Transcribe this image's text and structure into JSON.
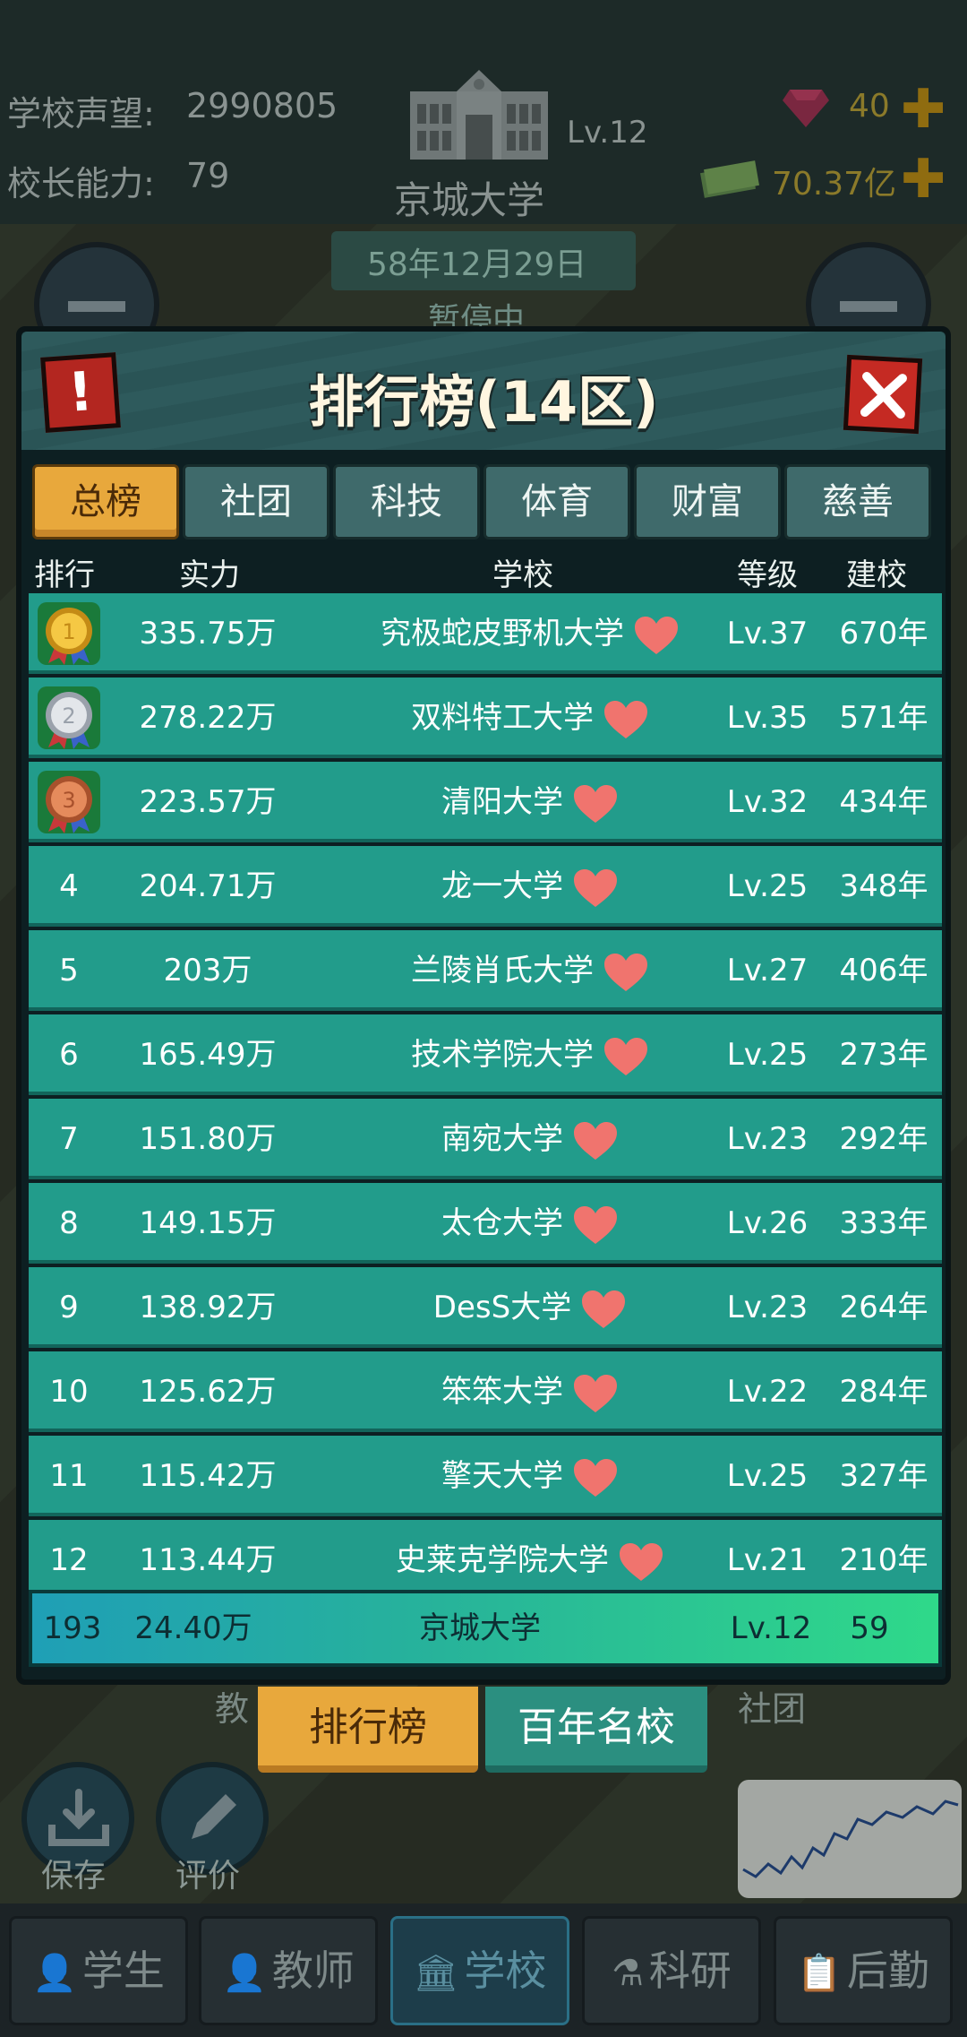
{
  "hud": {
    "reputation_label": "学校声望:",
    "reputation_value": "2990805",
    "ability_label": "校长能力:",
    "ability_value": "79",
    "level": "Lv.12",
    "school_name": "京城大学",
    "date": "58年12月29日",
    "paused": "暂停中",
    "gems": "40",
    "money": "70.37亿"
  },
  "modal": {
    "title": "排行榜(14区)",
    "tabs": [
      "总榜",
      "社团",
      "科技",
      "体育",
      "财富",
      "慈善"
    ],
    "active_tab": 0,
    "columns": [
      "排行",
      "实力",
      "学校",
      "等级",
      "建校"
    ],
    "rows": [
      {
        "rank": "1",
        "power": "335.75万",
        "school": "究极蛇皮野机大学",
        "level": "Lv.37",
        "founded": "670年",
        "medal": "gold"
      },
      {
        "rank": "2",
        "power": "278.22万",
        "school": "双料特工大学",
        "level": "Lv.35",
        "founded": "571年",
        "medal": "silver"
      },
      {
        "rank": "3",
        "power": "223.57万",
        "school": "清阳大学",
        "level": "Lv.32",
        "founded": "434年",
        "medal": "bronze"
      },
      {
        "rank": "4",
        "power": "204.71万",
        "school": "龙一大学",
        "level": "Lv.25",
        "founded": "348年"
      },
      {
        "rank": "5",
        "power": "203万",
        "school": "兰陵肖氏大学",
        "level": "Lv.27",
        "founded": "406年"
      },
      {
        "rank": "6",
        "power": "165.49万",
        "school": "技术学院大学",
        "level": "Lv.25",
        "founded": "273年"
      },
      {
        "rank": "7",
        "power": "151.80万",
        "school": "南宛大学",
        "level": "Lv.23",
        "founded": "292年"
      },
      {
        "rank": "8",
        "power": "149.15万",
        "school": "太仓大学",
        "level": "Lv.26",
        "founded": "333年"
      },
      {
        "rank": "9",
        "power": "138.92万",
        "school": "DesS大学",
        "level": "Lv.23",
        "founded": "264年"
      },
      {
        "rank": "10",
        "power": "125.62万",
        "school": "笨笨大学",
        "level": "Lv.22",
        "founded": "284年"
      },
      {
        "rank": "11",
        "power": "115.42万",
        "school": "擎天大学",
        "level": "Lv.25",
        "founded": "327年"
      },
      {
        "rank": "12",
        "power": "113.44万",
        "school": "史莱克学院大学",
        "level": "Lv.21",
        "founded": "210年"
      }
    ],
    "my_row": {
      "rank": "193",
      "power": "24.40万",
      "school": "京城大学",
      "level": "Lv.12",
      "founded": "59"
    }
  },
  "sub_tabs": {
    "rank": "排行榜",
    "famous": "百年名校"
  },
  "behind": {
    "left_label": "教",
    "right_label": "社团"
  },
  "tools": {
    "save": "保存",
    "review": "评价"
  },
  "nav": [
    "学生",
    "教师",
    "学校",
    "科研",
    "后勤"
  ],
  "colors": {
    "row": "#229c8b",
    "active_tab": "#e8a83c",
    "heart": "#f0746e",
    "accent_gold": "#e8a83c"
  }
}
